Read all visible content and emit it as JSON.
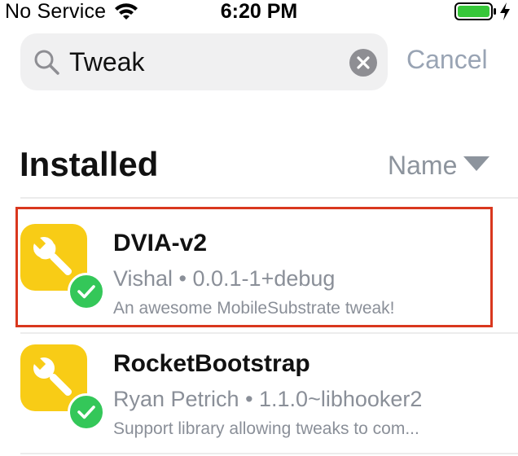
{
  "status_bar": {
    "carrier": "No Service",
    "time": "6:20 PM",
    "battery_color": "#37c739"
  },
  "search": {
    "query": "Tweak",
    "cancel_label": "Cancel"
  },
  "section": {
    "title": "Installed",
    "sort_label": "Name"
  },
  "packages": [
    {
      "name": "DVIA-v2",
      "author": "Vishal",
      "separator": "•",
      "version": "0.0.1-1+debug",
      "meta": "Vishal • 0.0.1-1+debug",
      "description": "An awesome MobileSubstrate tweak!",
      "icon": "wrench-icon",
      "installed": true,
      "highlighted": true
    },
    {
      "name": "RocketBootstrap",
      "author": "Ryan Petrich",
      "separator": "•",
      "version": "1.1.0~libhooker2",
      "meta": "Ryan Petrich • 1.1.0~libhooker2",
      "description": "Support library allowing tweaks to com...",
      "icon": "wrench-icon",
      "installed": true,
      "highlighted": false
    }
  ],
  "colors": {
    "accent_yellow": "#f8cc16",
    "installed_green": "#34c759",
    "highlight_red": "#d9371e",
    "muted_text": "#8a8f98"
  }
}
